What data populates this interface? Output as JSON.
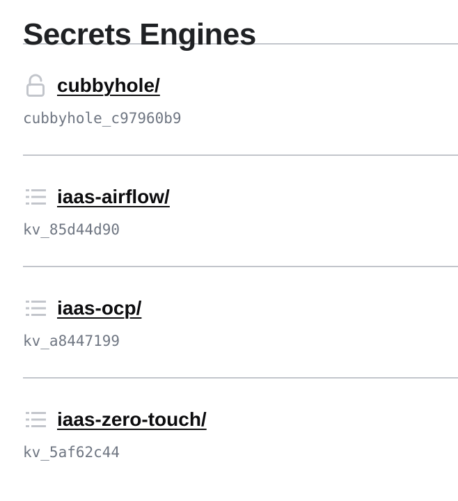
{
  "page": {
    "title": "Secrets Engines"
  },
  "engines": [
    {
      "path": "cubbyhole/",
      "accessor": "cubbyhole_c97960b9",
      "icon": "lock-open-icon"
    },
    {
      "path": "iaas-airflow/",
      "accessor": "kv_85d44d90",
      "icon": "list-icon"
    },
    {
      "path": "iaas-ocp/",
      "accessor": "kv_a8447199",
      "icon": "list-icon"
    },
    {
      "path": "iaas-zero-touch/",
      "accessor": "kv_5af62c44",
      "icon": "list-icon"
    }
  ],
  "colors": {
    "title": "#1f2124",
    "link": "#0c0c0e",
    "accessor": "#6f7682",
    "divider": "#c2c5cb",
    "icon": "#c2c5cb"
  }
}
